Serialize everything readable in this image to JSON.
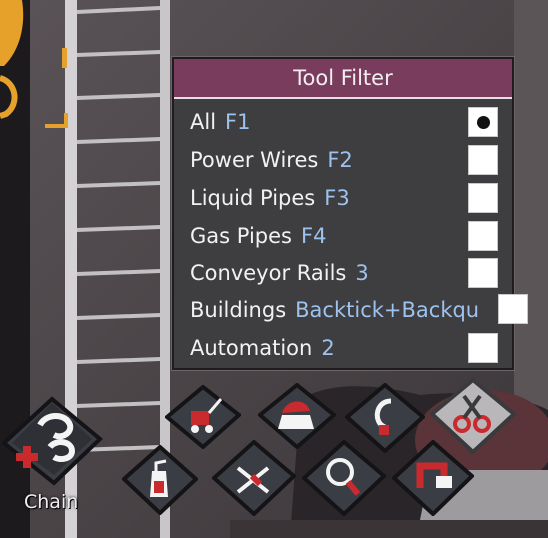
{
  "tool_filter": {
    "title": "Tool Filter",
    "options": [
      {
        "label": "All",
        "hotkey": "F1",
        "selected": true
      },
      {
        "label": "Power Wires",
        "hotkey": "F2",
        "selected": false
      },
      {
        "label": "Liquid Pipes",
        "hotkey": "F3",
        "selected": false
      },
      {
        "label": "Gas Pipes",
        "hotkey": "F4",
        "selected": false
      },
      {
        "label": "Conveyor Rails",
        "hotkey": "3",
        "selected": false
      },
      {
        "label": "Buildings",
        "hotkey": "Backtick+Backqu",
        "selected": false
      },
      {
        "label": "Automation",
        "hotkey": "2",
        "selected": false
      }
    ]
  },
  "toolbar": {
    "chain_label": "Chain",
    "tools": [
      {
        "icon": "chain-disconnect-icon"
      },
      {
        "icon": "mop-bucket-icon"
      },
      {
        "icon": "sweep-broom-icon"
      },
      {
        "icon": "hook-icon"
      },
      {
        "icon": "scissors-icon"
      },
      {
        "icon": "spray-bottle-icon"
      },
      {
        "icon": "harvest-icon"
      },
      {
        "icon": "magnifier-icon"
      },
      {
        "icon": "deconstruct-icon"
      }
    ]
  },
  "colors": {
    "panel_header": "#7a3c5c",
    "hotkey": "#9ec2ee",
    "accent_red": "#c92a2e"
  }
}
